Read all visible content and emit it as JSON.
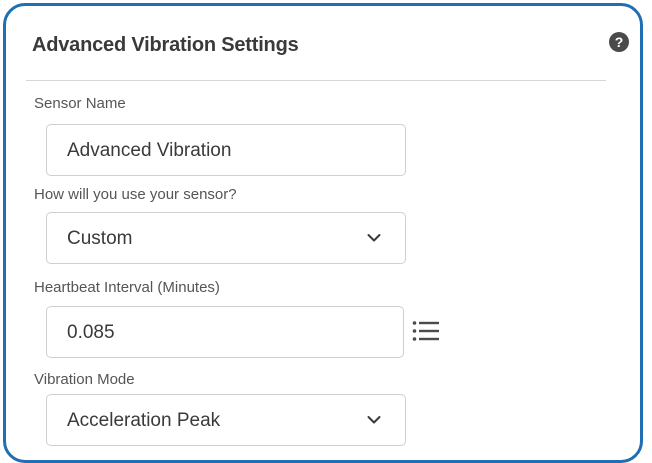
{
  "panel": {
    "title": "Advanced Vibration Settings",
    "help_icon": "question-circle-icon",
    "help_glyph": "?"
  },
  "fields": {
    "sensor_name": {
      "label": "Sensor Name",
      "value": "Advanced Vibration"
    },
    "usage": {
      "label": "How will you use your sensor?",
      "selected": "Custom",
      "icon": "chevron-down-icon"
    },
    "heartbeat": {
      "label": "Heartbeat Interval (Minutes)",
      "value": "0.085",
      "side_icon": "list-icon"
    },
    "vibration_mode": {
      "label": "Vibration Mode",
      "selected": "Acceleration Peak",
      "icon": "chevron-down-icon"
    }
  },
  "colors": {
    "border_accent": "#1f6fb2",
    "text": "#3a3a3a",
    "label": "#555555",
    "icon": "#4a4a4a"
  }
}
